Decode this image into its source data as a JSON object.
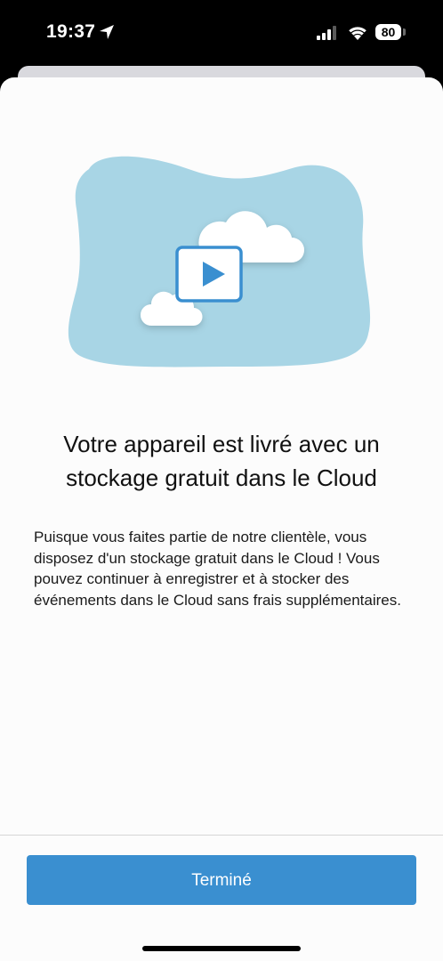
{
  "status_bar": {
    "time": "19:37",
    "battery": "80",
    "icons": [
      "location-arrow-icon",
      "signal-icon",
      "wifi-icon",
      "battery-icon"
    ]
  },
  "illustration": {
    "icons": [
      "blob-background",
      "cloud-icon",
      "play-icon"
    ],
    "colors": {
      "blob": "#a8d5e5",
      "accent": "#3a8fd0",
      "cloud": "#ffffff"
    }
  },
  "content": {
    "title": "Votre appareil est livré avec un stockage gratuit dans le Cloud",
    "description": "Puisque vous faites partie de notre clientèle, vous disposez d'un stockage gratuit dans le Cloud ! Vous pouvez continuer à enregistrer et à stocker des événements dans le Cloud sans frais supplémentaires."
  },
  "footer": {
    "done_label": "Terminé"
  },
  "colors": {
    "primary_button": "#3a8fd0",
    "sheet_background": "#fcfcfc",
    "status_bar_background": "#000000"
  }
}
